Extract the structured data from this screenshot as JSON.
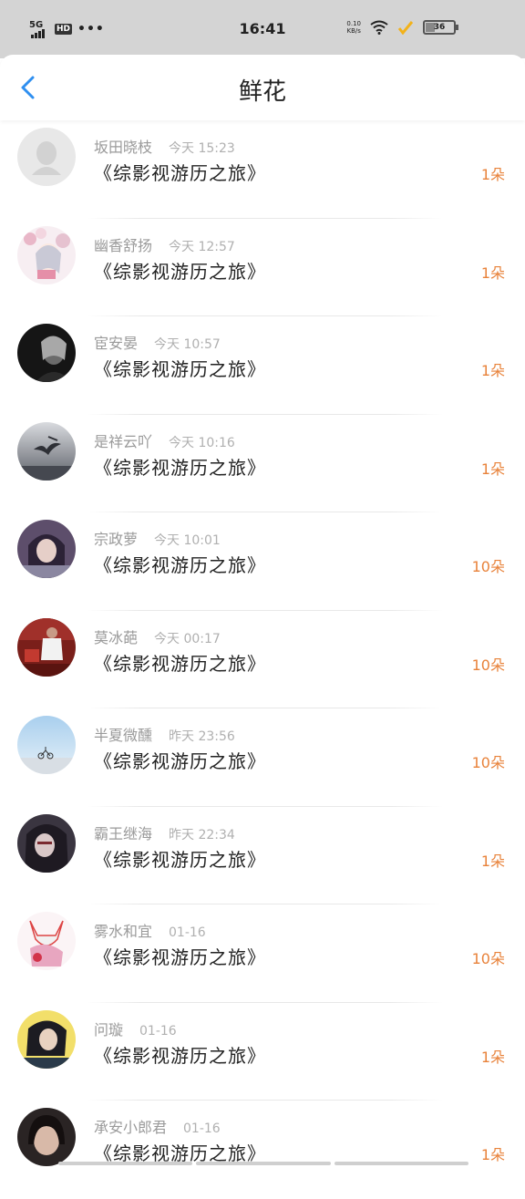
{
  "status_bar": {
    "network": "5G",
    "hd": "HD",
    "dots": "•••",
    "time": "16:41",
    "speed_value": "0.10",
    "speed_unit": "KB/s",
    "battery": "36"
  },
  "header": {
    "title": "鲜花",
    "back_icon": "chevron-left-icon"
  },
  "colors": {
    "accent_blue": "#2f8ff0",
    "amount_orange": "#e8823a"
  },
  "rows": [
    {
      "name": "坂田晓枝",
      "time": "今天 15:23",
      "book": "《综影视游历之旅》",
      "amount": "1朵",
      "avatar": "default-avatar-icon"
    },
    {
      "name": "幽香舒扬",
      "time": "今天 12:57",
      "book": "《综影视游历之旅》",
      "amount": "1朵",
      "avatar": "anime-girl-avatar"
    },
    {
      "name": "宦安晏",
      "time": "今天 10:57",
      "book": "《综影视游历之旅》",
      "amount": "1朵",
      "avatar": "dark-portrait-avatar"
    },
    {
      "name": "是祥云吖",
      "time": "今天 10:16",
      "book": "《综影视游历之旅》",
      "amount": "1朵",
      "avatar": "bird-sky-avatar"
    },
    {
      "name": "宗政萝",
      "time": "今天 10:01",
      "book": "《综影视游历之旅》",
      "amount": "10朵",
      "avatar": "anime-portrait-avatar"
    },
    {
      "name": "莫冰葩",
      "time": "今天 00:17",
      "book": "《综影视游历之旅》",
      "amount": "10朵",
      "avatar": "red-scene-avatar"
    },
    {
      "name": "半夏微醺",
      "time": "昨天 23:56",
      "book": "《综影视游历之旅》",
      "amount": "10朵",
      "avatar": "beach-bike-avatar"
    },
    {
      "name": "霸王继海",
      "time": "昨天 22:34",
      "book": "《综影视游历之旅》",
      "amount": "1朵",
      "avatar": "dark-anime-avatar"
    },
    {
      "name": "雾水和宜",
      "time": "01-16",
      "book": "《综影视游历之旅》",
      "amount": "10朵",
      "avatar": "fox-mask-avatar"
    },
    {
      "name": "问璇",
      "time": "01-16",
      "book": "《综影视游历之旅》",
      "amount": "1朵",
      "avatar": "yellow-portrait-avatar"
    },
    {
      "name": "承安小郎君",
      "time": "01-16",
      "book": "《综影视游历之旅》",
      "amount": "1朵",
      "avatar": "girl-photo-avatar"
    }
  ]
}
